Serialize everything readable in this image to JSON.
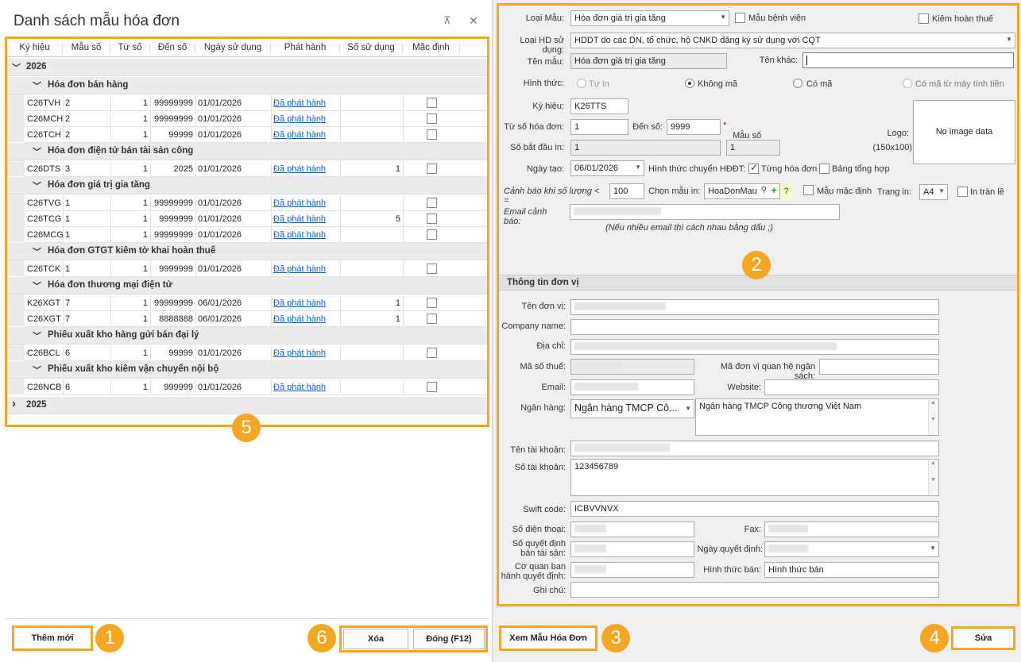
{
  "left_panel": {
    "title": "Danh sách mẫu hóa đơn",
    "pin_icon": "pin-icon",
    "close_icon": "close-icon",
    "columns": [
      "Ký hiệu",
      "Mẫu số",
      "Từ số",
      "Đến số",
      "Ngày sử dụng",
      "Phát hành",
      "Số sử dụng",
      "Mặc định"
    ],
    "year_2026": "2026",
    "year_2025": "2025",
    "groups": [
      {
        "name": "Hóa đơn bán hàng",
        "rows": [
          {
            "kh": "C26TVH",
            "ms": "2",
            "tu": "1",
            "den": "99999999",
            "ngay": "01/01/2026",
            "ph": "Đã phát hành",
            "ssd": "",
            "md": false
          },
          {
            "kh": "C26MCH",
            "ms": "2",
            "tu": "1",
            "den": "99999999",
            "ngay": "01/01/2026",
            "ph": "Đã phát hành",
            "ssd": "",
            "md": false
          },
          {
            "kh": "C26TCH",
            "ms": "2",
            "tu": "1",
            "den": "99999",
            "ngay": "01/01/2026",
            "ph": "Đã phát hành",
            "ssd": "",
            "md": false
          }
        ]
      },
      {
        "name": "Hóa đơn điện tử bán tài sản công",
        "rows": [
          {
            "kh": "C26DTS",
            "ms": "3",
            "tu": "1",
            "den": "2025",
            "ngay": "01/01/2026",
            "ph": "Đã phát hành",
            "ssd": "1",
            "md": false
          }
        ]
      },
      {
        "name": "Hóa đơn giá trị gia tăng",
        "rows": [
          {
            "kh": "C26TVG",
            "ms": "1",
            "tu": "1",
            "den": "99999999",
            "ngay": "01/01/2026",
            "ph": "Đã phát hành",
            "ssd": "",
            "md": false
          },
          {
            "kh": "C26TCG",
            "ms": "1",
            "tu": "1",
            "den": "9999999",
            "ngay": "01/01/2026",
            "ph": "Đã phát hành",
            "ssd": "5",
            "md": false
          },
          {
            "kh": "C26MCG",
            "ms": "1",
            "tu": "1",
            "den": "99999999",
            "ngay": "01/01/2026",
            "ph": "Đã phát hành",
            "ssd": "",
            "md": false
          }
        ]
      },
      {
        "name": "Hóa đơn GTGT kiêm tờ khai hoàn thuế",
        "rows": [
          {
            "kh": "C26TCK",
            "ms": "1",
            "tu": "1",
            "den": "9999999",
            "ngay": "01/01/2026",
            "ph": "Đã phát hành",
            "ssd": "",
            "md": false
          }
        ]
      },
      {
        "name": "Hóa đơn thương mại điện tử",
        "rows": [
          {
            "kh": "K26XGT",
            "ms": "7",
            "tu": "1",
            "den": "99999999",
            "ngay": "06/01/2026",
            "ph": "Đã phát hành",
            "ssd": "1",
            "md": false
          },
          {
            "kh": "C26XGT",
            "ms": "7",
            "tu": "1",
            "den": "8888888",
            "ngay": "06/01/2026",
            "ph": "Đã phát hành",
            "ssd": "1",
            "md": false
          }
        ]
      },
      {
        "name": "Phiếu xuất kho hàng gửi bán đại lý",
        "rows": [
          {
            "kh": "C26BCL",
            "ms": "6",
            "tu": "1",
            "den": "99999",
            "ngay": "01/01/2026",
            "ph": "Đã phát hành",
            "ssd": "",
            "md": false
          }
        ]
      },
      {
        "name": "Phiếu xuất kho kiêm vận chuyển nội bộ",
        "rows": [
          {
            "kh": "C26NCB",
            "ms": "6",
            "tu": "1",
            "den": "999999",
            "ngay": "01/01/2026",
            "ph": "Đã phát hành",
            "ssd": "",
            "md": false
          }
        ]
      }
    ],
    "btn_new": "Thêm mới",
    "btn_delete": "Xóa",
    "btn_close": "Đóng (F12)"
  },
  "badges": [
    "1",
    "2",
    "3",
    "4",
    "5",
    "6"
  ],
  "form": {
    "loai_mau_label": "Loại Mẫu:",
    "loai_mau_value": "Hóa đơn giá trị gia tăng",
    "mau_benh_vien": "Mẫu bệnh viện",
    "kiem_hoan_thue": "Kiêm hoàn thuế",
    "loai_hd_label": "Loại HD sử dụng:",
    "loai_hd_value": "HDDT do các DN, tổ chức, hộ CNKD đăng ký sử dụng với CQT",
    "ten_mau_label": "Tên mẫu:",
    "ten_mau_value": "Hóa đơn giá trị gia tăng",
    "ten_khac_label": "Tên khác:",
    "ten_khac_value": "",
    "hinh_thuc_label": "Hình thức:",
    "ht_tu_in": "Tự in",
    "ht_khong_ma": "Không mã",
    "ht_co_ma": "Có mã",
    "ht_co_ma_may": "Có mã từ máy tính tiền",
    "ky_hieu_label": "Ký hiệu:",
    "ky_hieu_value": "K26TTS",
    "tu_so_label": "Từ số hóa đơn:",
    "tu_so_value": "1",
    "den_so_label": "Đến số:",
    "den_so_value": "9999",
    "required_star": "*",
    "so_bat_dau_label": "Số bắt đầu in:",
    "so_bat_dau_value": "1",
    "mau_so_label": "Mẫu số",
    "mau_so_value": "1",
    "logo_label": "Logo:",
    "logo_size": "(150x100)",
    "logo_placeholder": "No image data",
    "ngay_tao_label": "Ngày tạo:",
    "ngay_tao_value": "06/01/2026",
    "ht_chuyen_label": "Hình thức chuyển HĐĐT:",
    "tung_hoa_don": "Từng hóa đơn",
    "bang_tong_hop": "Bảng tổng hợp",
    "canh_bao_label": "Cảnh báo khi số lượng < =",
    "canh_bao_value": "100",
    "chon_mau_label": "Chọn mẫu in:",
    "chon_mau_value": "HoaDonMau",
    "help_mark": "?",
    "mau_mac_dinh": "Mẫu mặc định",
    "trang_in_label": "Trang in:",
    "trang_in_value": "A4",
    "in_tran_le": "In tràn lề",
    "email_cb_label": "Email cảnh báo:",
    "email_note": "(Nếu nhiều email thì cách nhau bằng dấu ;)"
  },
  "don_vi": {
    "section_title": "Thông tin đơn vị",
    "ten_don_vi": "Tên đơn vị:",
    "company_name": "Company name:",
    "dia_chi": "Địa chỉ:",
    "mst": "Mã số thuế:",
    "ma_qhns": "Mã đơn vị quan hệ ngân sách:",
    "email": "Email:",
    "website": "Website:",
    "ngan_hang": "Ngân hàng:",
    "ngan_hang_value": "Ngân hàng TMCP Cô...",
    "ngan_hang_full": "Ngân hàng TMCP Công thương Việt Nam",
    "ten_tk": "Tên tài khoản:",
    "so_tk": "Số tài khoản:",
    "so_tk_value": "123456789",
    "swift": "Swift code:",
    "swift_value": "ICBVVNVX",
    "sdt": "Số điện thoại:",
    "fax": "Fax:",
    "so_qd_line1": "Số quyết định",
    "so_qd_line2": "bán tài sản:",
    "ngay_qd": "Ngày quyết định:",
    "cq_line1": "Cơ quan ban",
    "cq_line2": "hành quyết định:",
    "hinh_thuc_ban": "Hình thức bán:",
    "hinh_thuc_ban_value": "Hình thức bán",
    "ghi_chu": "Ghi chú:"
  },
  "bottom": {
    "xem_mau": "Xem Mẫu Hóa Đơn",
    "sua": "Sửa"
  },
  "colors": {
    "accent": "#f5a623",
    "link": "#1a5fb4"
  }
}
